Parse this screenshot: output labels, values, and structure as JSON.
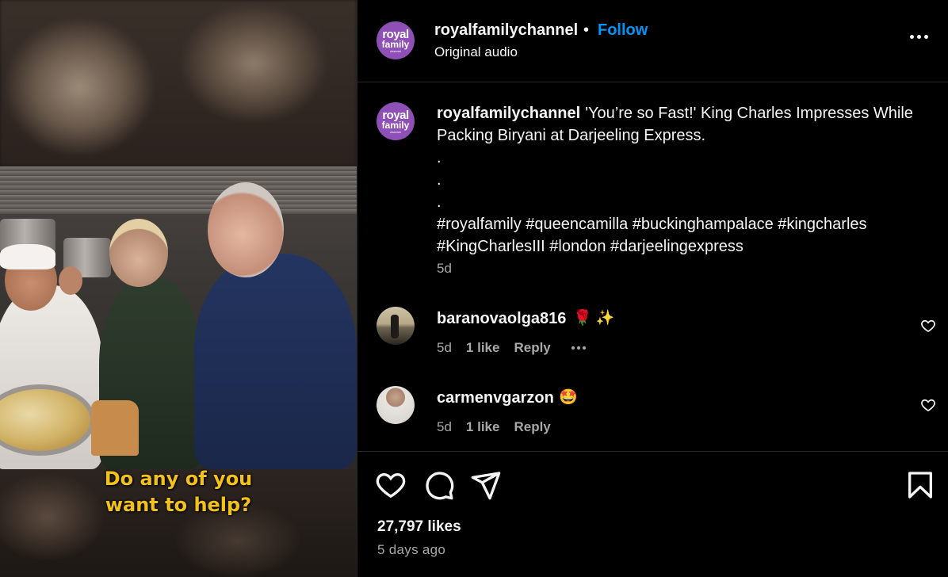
{
  "media": {
    "overlay_caption_line1": "Do any of you",
    "overlay_caption_line2": "want to help?"
  },
  "header": {
    "avatar_text": [
      "royal",
      "family",
      "channel"
    ],
    "username": "royalfamilychannel",
    "separator": "•",
    "follow_label": "Follow",
    "audio": "Original audio"
  },
  "caption": {
    "username": "royalfamilychannel",
    "text": "'You’re so Fast!' King Charles Impresses While Packing Biryani at Darjeeling Express.",
    "dots": [
      ".",
      ".",
      "."
    ],
    "hashtags_line1": "#royalfamily #queencamilla #buckinghampalace #kingcharles",
    "hashtags_line2": "#KingCharlesIII #london #darjeelingexpress",
    "time": "5d"
  },
  "comments": [
    {
      "username": "baranovaolga816",
      "emoji": "🌹 ✨",
      "time": "5d",
      "likes": "1 like",
      "reply": "Reply"
    },
    {
      "username": "carmenvgarzon",
      "emoji": "🤩",
      "time": "5d",
      "likes": "1 like",
      "reply": "Reply"
    }
  ],
  "actions": {
    "icons": [
      "heart-icon",
      "comment-icon",
      "share-icon",
      "bookmark-icon"
    ],
    "likes": "27,797 likes",
    "posted": "5 days ago"
  },
  "colors": {
    "follow": "#0095f6",
    "avatar": "#8e4fb6",
    "caption_overlay": "#f2c21b",
    "muted_text": "#a8a8a8"
  }
}
